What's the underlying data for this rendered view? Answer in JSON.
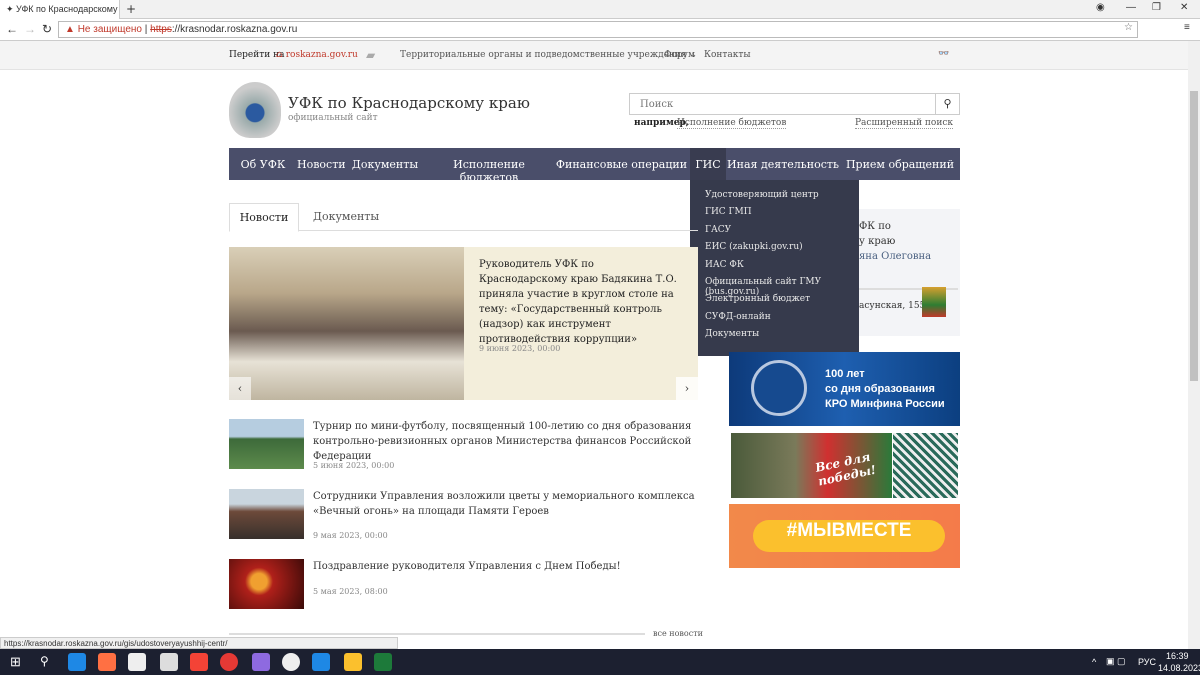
{
  "browser": {
    "tab_title": "УФК по Краснодарскому",
    "security": "Не защищено",
    "url_scheme": "https",
    "url_rest": "://krasnodar.roskazna.gov.ru",
    "status_url": "https://krasnodar.roskazna.gov.ru/gis/udostoveryayushhij-centr/"
  },
  "topbar": {
    "goto_label": "Перейти на",
    "goto_link": "roskazna.gov.ru",
    "territorial": "Территориальные органы и подведомственные учреждения",
    "forum": "Форум",
    "contacts": "Контакты"
  },
  "header": {
    "title": "УФК по Краснодарскому краю",
    "subtitle": "официальный сайт",
    "search_placeholder": "Поиск",
    "example_label": "например,",
    "example_link": "Исполнение бюджетов",
    "advanced": "Расширенный поиск"
  },
  "nav": [
    "Об УФК",
    "Новости",
    "Документы",
    "Исполнение бюджетов",
    "Финансовые операции",
    "ГИС",
    "Иная деятельность",
    "Прием обращений"
  ],
  "gis_menu": [
    "Удостоверяющий центр",
    "ГИС ГМП",
    "ГАСУ",
    "ЕИС (zakupki.gov.ru)",
    "ИАС ФК",
    "Официальный сайт ГМУ (bus.gov.ru)",
    "Электронный бюджет",
    "СУФД-онлайн",
    "Документы"
  ],
  "content_tabs": [
    "Новости",
    "Документы"
  ],
  "hero": {
    "title": "Руководитель УФК по Краснодарскому краю Бадякина Т.О. приняла участие в круглом столе на тему: «Государственный контроль (надзор) как инструмент противодействия коррупции»",
    "date": "9 июня 2023, 00:00"
  },
  "news": [
    {
      "title": "Турнир по мини-футболу, посвященный 100-летию со дня образования контрольно-ревизионных органов Министерства финансов Российской Федерации",
      "date": "5 июня 2023, 00:00"
    },
    {
      "title": "Сотрудники Управления возложили цветы у мемориального комплекса «Вечный огонь» на площади Памяти Героев",
      "date": "9 мая 2023, 00:00"
    },
    {
      "title": "Поздравление руководителя Управления с Днем Победы!",
      "date": "5 мая 2023, 08:00"
    }
  ],
  "all_news": "все новости",
  "sidebar": {
    "head_line1": "ФК по",
    "head_line2": "у краю",
    "head_name": "яна Олеговна",
    "address": "асунская, 155"
  },
  "banners": {
    "kro_line1": "100 лет",
    "kro_line2": "со дня образования",
    "kro_line3": "КРО Минфина России",
    "victory": "Все для победы!",
    "myvmeste": "#МЫВМЕСТЕ"
  },
  "taskbar": {
    "lang": "РУС",
    "time": "16:39",
    "date": "14.08.2023"
  },
  "colors": {
    "nav": "#4a4e6a",
    "nav_active": "#393c50",
    "dropdown": "#363a4c",
    "link": "#c0392b"
  }
}
